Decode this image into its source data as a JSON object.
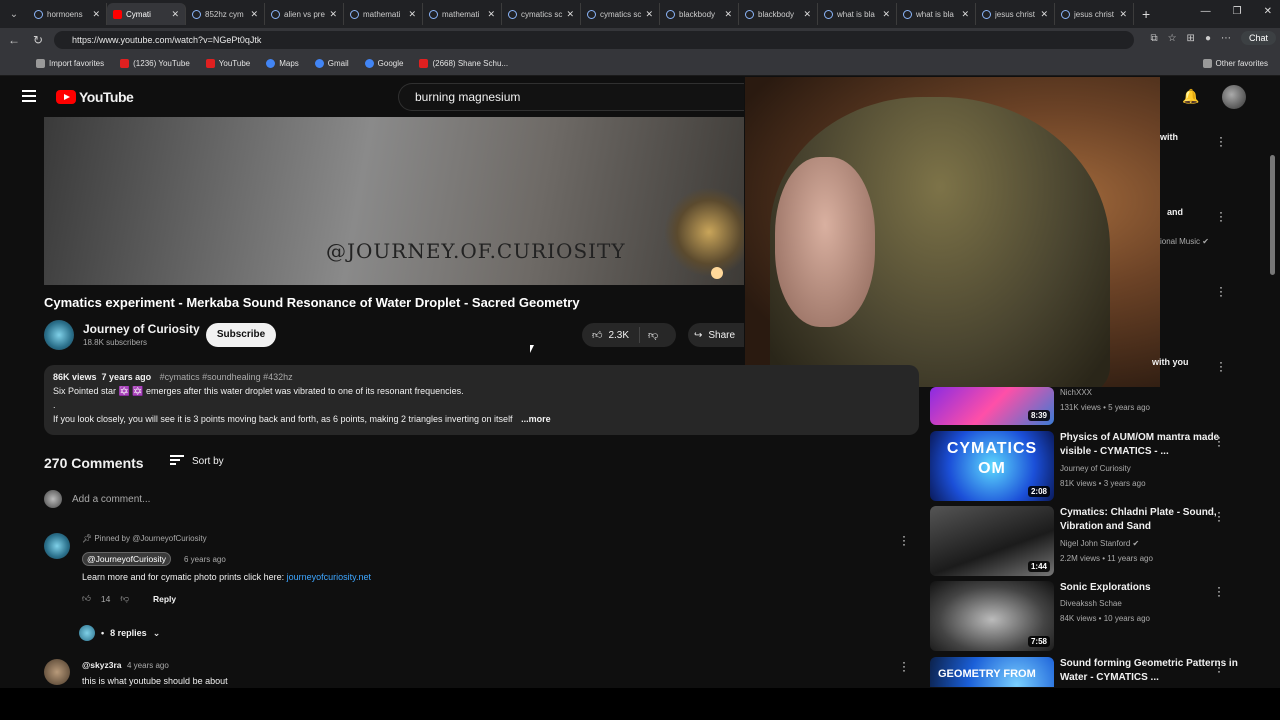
{
  "browser": {
    "tabs": [
      {
        "label": "hormoens",
        "active": false
      },
      {
        "label": "Cymati",
        "active": true
      },
      {
        "label": "852hz cym",
        "active": false
      },
      {
        "label": "alien vs pre",
        "active": false
      },
      {
        "label": "mathemati",
        "active": false
      },
      {
        "label": "mathemati",
        "active": false
      },
      {
        "label": "cymatics sc",
        "active": false
      },
      {
        "label": "cymatics sc",
        "active": false
      },
      {
        "label": "blackbody",
        "active": false
      },
      {
        "label": "blackbody",
        "active": false
      },
      {
        "label": "what is bla",
        "active": false
      },
      {
        "label": "what is bla",
        "active": false
      },
      {
        "label": "jesus christ",
        "active": false
      },
      {
        "label": "jesus christ",
        "active": false
      }
    ],
    "url": "https://www.youtube.com/watch?v=NGePt0qJtk",
    "chat_label": "Chat",
    "bookmarks": [
      {
        "label": "Import favorites",
        "icon": "folder-icon"
      },
      {
        "label": "(1236) YouTube",
        "icon": "youtube-icon"
      },
      {
        "label": "YouTube",
        "icon": "youtube-icon"
      },
      {
        "label": "Maps",
        "icon": "maps-icon"
      },
      {
        "label": "Gmail",
        "icon": "gmail-icon"
      },
      {
        "label": "Google",
        "icon": "google-icon"
      },
      {
        "label": "(2668) Shane Schu...",
        "icon": "youtube-icon"
      }
    ],
    "other_favorites": "Other favorites"
  },
  "youtube": {
    "logo_text": "YouTube",
    "search_value": "burning magnesium"
  },
  "player": {
    "watermark": "@JOURNEY.OF.CURIOSITY"
  },
  "video": {
    "title": "Cymatics experiment - Merkaba Sound Resonance of Water Droplet - Sacred Geometry",
    "channel": "Journey of Curiosity",
    "subscribers": "18.8K subscribers",
    "subscribe_label": "Subscribe",
    "likes": "2.3K",
    "share_label": "Share"
  },
  "description": {
    "views": "86K views",
    "age": "7 years ago",
    "tags": "#cymatics #soundhealing #432hz",
    "line1": "Six Pointed star ✡️ ✡️ emerges after this water droplet was vibrated to one of its resonant frequencies.",
    "line2": ".",
    "line3": "If you look closely, you will see it is 3 points moving back and forth, as 6 points, making 2 triangles inverting on itself",
    "more_label": "...more"
  },
  "comments": {
    "count_label": "270 Comments",
    "sort_label": "Sort by",
    "add_placeholder": "Add a comment...",
    "pinned": "Pinned by @JourneyofCuriosity",
    "c1_user": "@JourneyofCuriosity",
    "c1_age": "6 years ago",
    "c1_text": "Learn more and for cymatic photo prints click here:",
    "c1_link": "journeyofcuriosity.net",
    "c1_likes": "14",
    "reply_label": "Reply",
    "replies_label": "8 replies",
    "c2_user": "@skyz3ra",
    "c2_age": "4 years ago",
    "c2_text": "this is what youtube should be about"
  },
  "related": {
    "partial": {
      "t1": "with",
      "t2": "and",
      "t3": "ional Music",
      "t4": "with you"
    },
    "items": [
      {
        "title": "",
        "channel": "NichXXX",
        "meta": "131K views • 5 years ago",
        "duration": "8:39"
      },
      {
        "title": "Physics of AUM/OM mantra made visible - CYMATICS - ...",
        "channel": "Journey of Curiosity",
        "meta": "81K views • 3 years ago",
        "duration": "2:08",
        "thumb_text": "CYMATICS OM"
      },
      {
        "title": "Cymatics: Chladni Plate - Sound, Vibration and Sand",
        "channel": "Nigel John Stanford",
        "meta": "2.2M views • 11 years ago",
        "duration": "1:44"
      },
      {
        "title": "Sonic Explorations",
        "channel": "Diveakssh Schae",
        "meta": "84K views • 10 years ago",
        "duration": "7:58"
      },
      {
        "title": "Sound forming Geometric Patterns in Water - CYMATICS ...",
        "channel": "",
        "meta": "",
        "duration": "",
        "thumb_text": "GEOMETRY FROM"
      }
    ]
  }
}
